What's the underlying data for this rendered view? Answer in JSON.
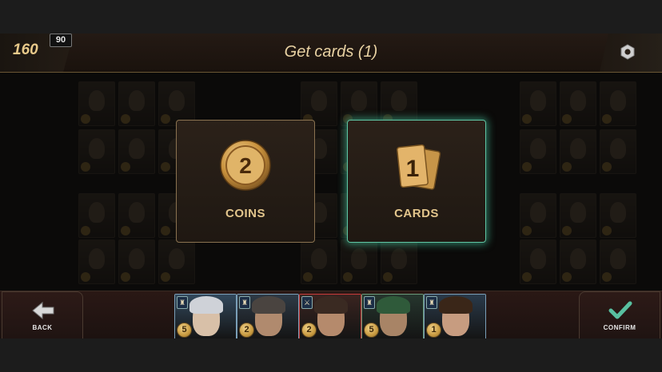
{
  "header": {
    "coins": "160",
    "badge": "90",
    "title": "Get cards (1)",
    "settings_icon": "hex-gear-icon"
  },
  "choices": [
    {
      "id": "coins",
      "value": "2",
      "label": "COINS",
      "icon": "coin-icon",
      "selected": false
    },
    {
      "id": "cards",
      "value": "1",
      "label": "CARDS",
      "icon": "cards-icon",
      "selected": true
    }
  ],
  "footer": {
    "back_label": "BACK",
    "back_icon": "back-arrow-icon",
    "confirm_label": "CONFIRM",
    "confirm_icon": "checkmark-icon"
  },
  "hand": [
    {
      "name": "elderly-woman",
      "cost": "5",
      "badge": "♜",
      "frame": "#7a9fb8",
      "bg": "#32485c",
      "face": "#d8c0a8",
      "hair": "#cfd2d8"
    },
    {
      "name": "man-gray-hair",
      "cost": "2",
      "badge": "♜",
      "frame": "#7a9fb8",
      "bg": "#2e3a46",
      "face": "#b08a6e",
      "hair": "#4a4440"
    },
    {
      "name": "red-frame-man",
      "cost": "2",
      "badge": "⚔",
      "frame": "#c83a3a",
      "bg": "#3a2420",
      "face": "#b58a6c",
      "hair": "#3a2a22"
    },
    {
      "name": "beret-soldier",
      "cost": "5",
      "badge": "♜",
      "frame": "#6a9a7a",
      "bg": "#26362e",
      "face": "#a88466",
      "hair": "#2f5a3a"
    },
    {
      "name": "young-man",
      "cost": "1",
      "badge": "♜",
      "frame": "#7a9fb8",
      "bg": "#2a3a4a",
      "face": "#c79c80",
      "hair": "#3a2618"
    }
  ],
  "colors": {
    "accent": "#e2c58c",
    "selected_glow": "#5fc5a4"
  }
}
